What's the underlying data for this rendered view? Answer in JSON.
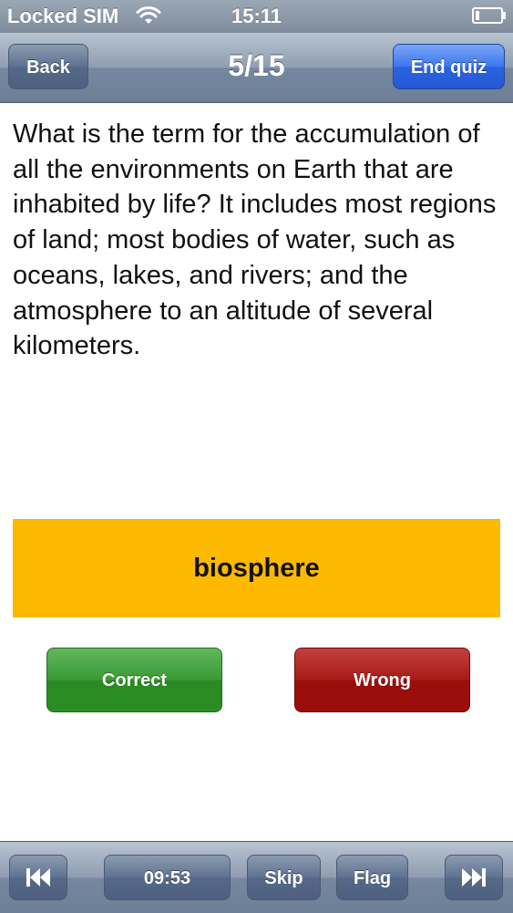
{
  "status_bar": {
    "carrier": "Locked SIM",
    "time": "15:11",
    "wifi_icon": "wifi-icon",
    "battery_icon": "battery-icon"
  },
  "nav": {
    "back_label": "Back",
    "title": "5/15",
    "end_quiz_label": "End quiz"
  },
  "question": {
    "text": "What is the term for the accumulation of all the environments on Earth that are inhabited by life? It includes most regions of land; most bodies of water, such as oceans, lakes, and rivers; and the atmosphere to an altitude of several kilometers."
  },
  "answer": {
    "text": "biosphere",
    "color": "#fdb900"
  },
  "actions": {
    "correct_label": "Correct",
    "wrong_label": "Wrong",
    "correct_color": "#3a9a33",
    "wrong_color": "#a81a16"
  },
  "toolbar": {
    "prev_icon": "skip-back-icon",
    "timer": "09:53",
    "skip_label": "Skip",
    "flag_label": "Flag",
    "next_icon": "skip-forward-icon"
  }
}
